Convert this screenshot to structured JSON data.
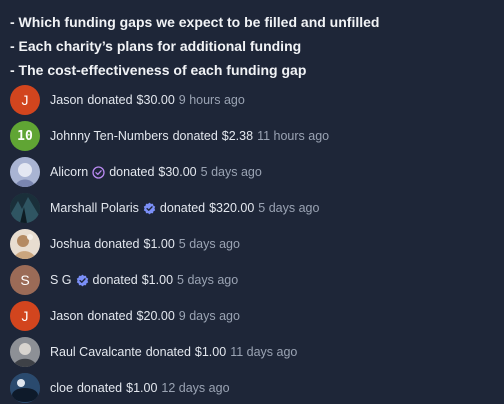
{
  "bullets": [
    "- Which funding gaps we expect to be filled and unfilled",
    "- Each charity’s plans for additional funding",
    "- The cost-effectiveness of each funding gap"
  ],
  "donations": [
    {
      "avatar": "J",
      "avatar_kind": "letter",
      "avatar_color": "#d2451e",
      "name": "Jason",
      "badge": null,
      "action": "donated",
      "amount": "$30.00",
      "ago": "9 hours ago"
    },
    {
      "avatar": "10",
      "avatar_kind": "letter",
      "avatar_color": "#60a534",
      "name": "Johnny Ten-Numbers",
      "badge": null,
      "action": "donated",
      "amount": "$2.38",
      "ago": "11 hours ago"
    },
    {
      "avatar": "",
      "avatar_kind": "photo",
      "avatar_color": "#8fa0c8",
      "name": "Alicorn",
      "badge": "purple-check-outline-icon",
      "action": "donated",
      "amount": "$30.00",
      "ago": "5 days ago"
    },
    {
      "avatar": "",
      "avatar_kind": "photo",
      "avatar_color": "#2c4a55",
      "name": "Marshall Polaris",
      "badge": "blue-verified-icon",
      "action": "donated",
      "amount": "$320.00",
      "ago": "5 days ago"
    },
    {
      "avatar": "",
      "avatar_kind": "photo",
      "avatar_color": "#d9c7b0",
      "name": "Joshua",
      "badge": null,
      "action": "donated",
      "amount": "$1.00",
      "ago": "5 days ago"
    },
    {
      "avatar": "S",
      "avatar_kind": "letter",
      "avatar_color": "#9b6b57",
      "name": "S G",
      "badge": "blue-verified-icon",
      "action": "donated",
      "amount": "$1.00",
      "ago": "5 days ago"
    },
    {
      "avatar": "J",
      "avatar_kind": "letter",
      "avatar_color": "#d2451e",
      "name": "Jason",
      "badge": null,
      "action": "donated",
      "amount": "$20.00",
      "ago": "9 days ago"
    },
    {
      "avatar": "",
      "avatar_kind": "photo",
      "avatar_color": "#6c6f75",
      "name": "Raul Cavalcante",
      "badge": null,
      "action": "donated",
      "amount": "$1.00",
      "ago": "11 days ago"
    },
    {
      "avatar": "",
      "avatar_kind": "photo",
      "avatar_color": "#1f3550",
      "name": "cloe",
      "badge": null,
      "action": "donated",
      "amount": "$1.00",
      "ago": "12 days ago"
    }
  ]
}
